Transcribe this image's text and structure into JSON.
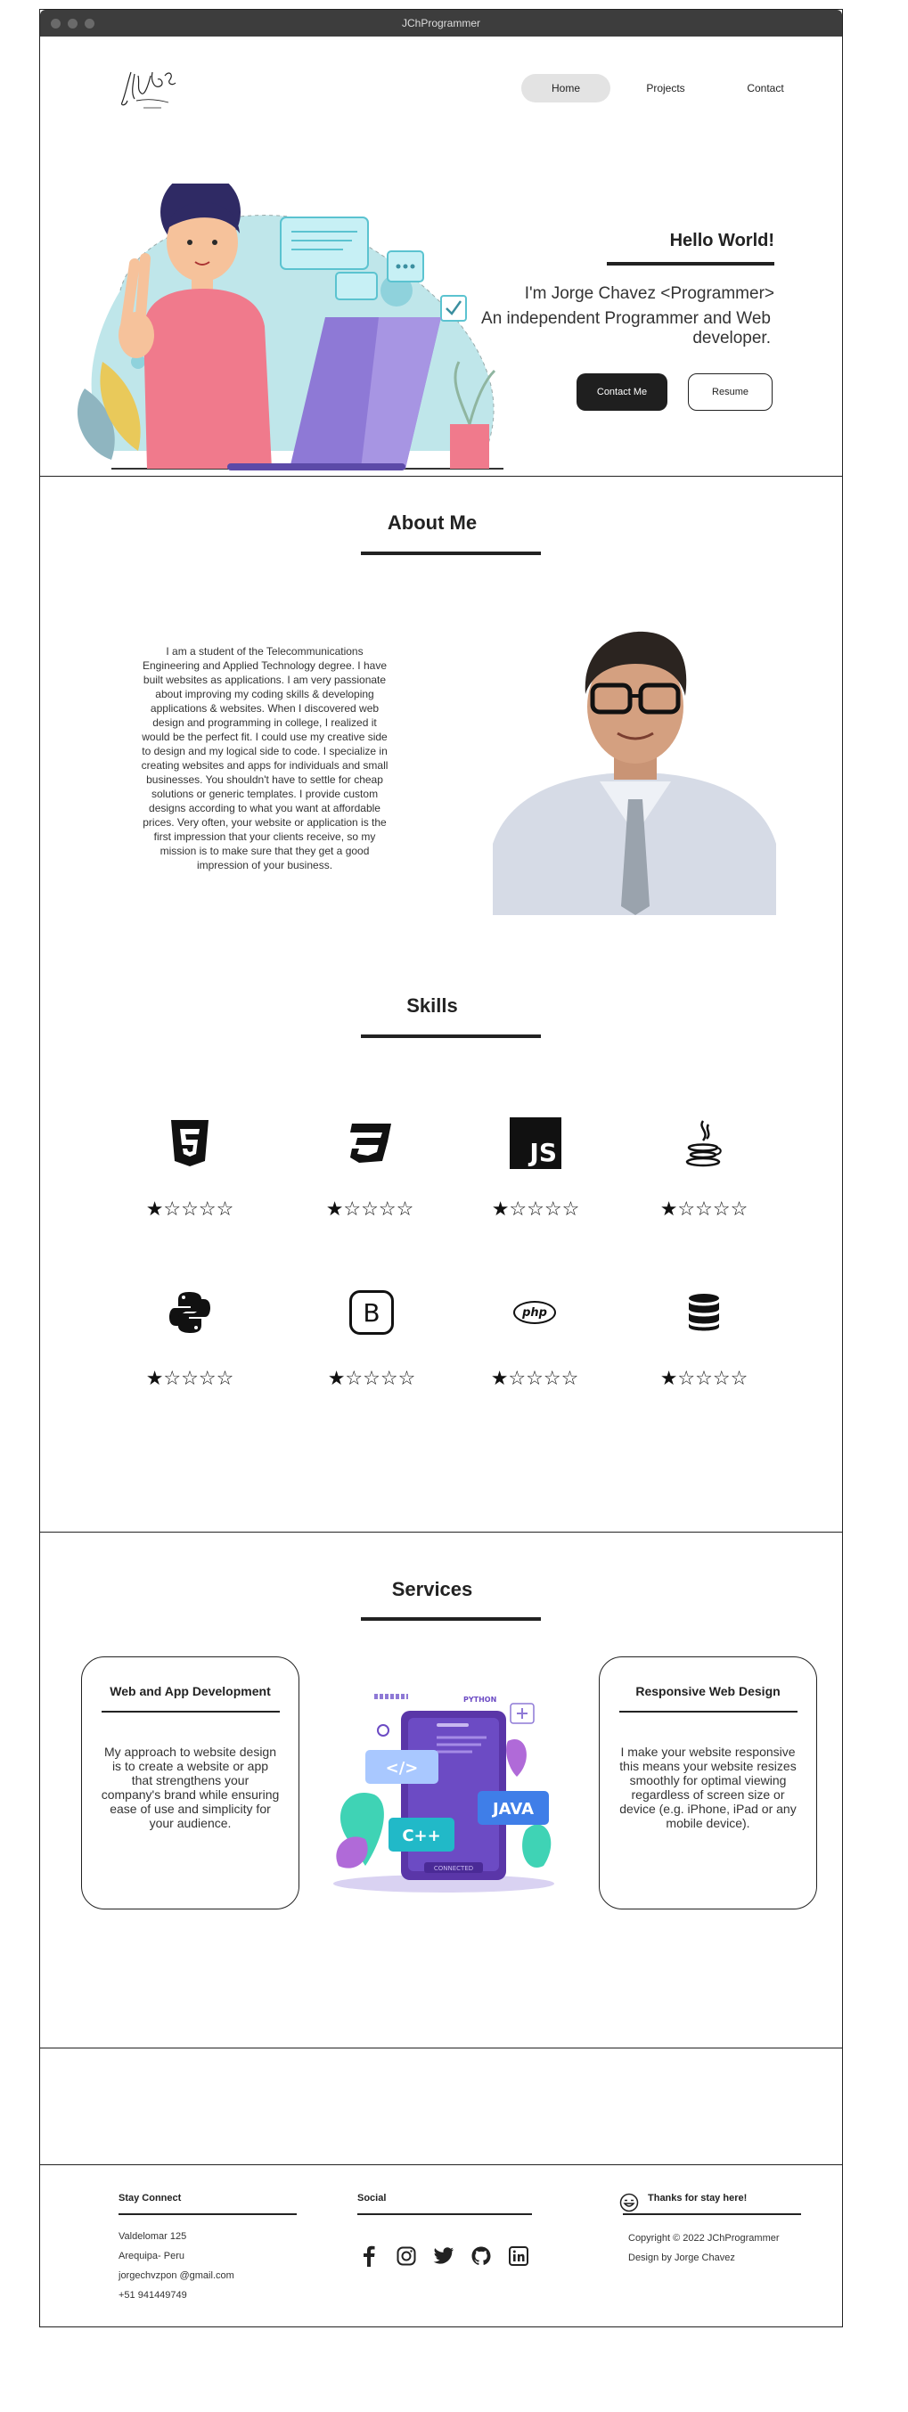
{
  "window": {
    "title": "JChProgrammer"
  },
  "nav": {
    "items": [
      "Home",
      "Projects",
      "Contact"
    ]
  },
  "hero": {
    "greeting": "Hello World!",
    "intro": "I'm Jorge Chavez <Programmer>",
    "tagline": "An independent Programmer and Web developer.",
    "contact_button": "Contact Me",
    "resume_button": "Resume"
  },
  "about": {
    "title": "About Me",
    "text": "I am a student of the Telecommunications Engineering and Applied Technology degree. I have built websites as applications. I am very passionate about improving my coding skills & developing applications & websites. When I discovered web design and programming in college, I realized it would be the perfect fit. I could use my creative side to design and my logical side to code. I specialize in creating websites and apps for individuals and small businesses. You shouldn't have to settle for cheap solutions or generic templates. I provide custom designs according to what you want at affordable prices. Very often, your website or application is the first impression that your clients receive, so my mission is to make sure that they get a good impression of your business."
  },
  "skills": {
    "title": "Skills",
    "items": [
      {
        "icon": "html5-icon",
        "rating": 1,
        "stars": "★☆☆☆☆"
      },
      {
        "icon": "css3-icon",
        "rating": 1,
        "stars": "★☆☆☆☆"
      },
      {
        "icon": "javascript-icon",
        "rating": 1,
        "stars": "★☆☆☆☆",
        "label": "JS"
      },
      {
        "icon": "java-icon",
        "rating": 1,
        "stars": "★☆☆☆☆"
      },
      {
        "icon": "python-icon",
        "rating": 1,
        "stars": "★☆☆☆☆"
      },
      {
        "icon": "bootstrap-icon",
        "rating": 1,
        "stars": "★☆☆☆☆",
        "label": "B"
      },
      {
        "icon": "php-icon",
        "rating": 1,
        "stars": "★☆☆☆☆",
        "label": "php"
      },
      {
        "icon": "database-icon",
        "rating": 1,
        "stars": "★☆☆☆☆"
      }
    ]
  },
  "services": {
    "title": "Services",
    "cards": [
      {
        "title": "Web and App Development",
        "text": "My approach to website design is to create a website or app that strengthens your company's brand while ensuring ease of use and simplicity for your audience."
      },
      {
        "title": "Responsive Web Design",
        "text": "I make your website responsive this means your website resizes smoothly for optimal viewing regardless of screen size or device (e.g. iPhone, iPad or any mobile device)."
      }
    ],
    "illustration_labels": {
      "python": "PYTHON",
      "java": "JAVA",
      "cpp": "C++",
      "code": "</>",
      "connected": "CONNECTED"
    }
  },
  "footer": {
    "contact_title": "Stay Connect",
    "contact_lines": [
      "Valdelomar 125",
      "Arequipa- Peru",
      "jorgechvzpon @gmail.com",
      "+51 941449749"
    ],
    "social_title": "Social",
    "social_icons": [
      "facebook-icon",
      "instagram-icon",
      "twitter-icon",
      "github-icon",
      "linkedin-icon"
    ],
    "thanks_title": "Thanks for stay here!",
    "copyright": "Copyright ©  2022 JChProgrammer",
    "credit": "Design by Jorge Chavez"
  },
  "colors": {
    "dark": "#1f1f1f",
    "titlebar": "#3d3d3d",
    "nav_active": "#e3e3e3",
    "accent_purple": "#6c4bc4",
    "accent_teal": "#3fd3b5"
  }
}
